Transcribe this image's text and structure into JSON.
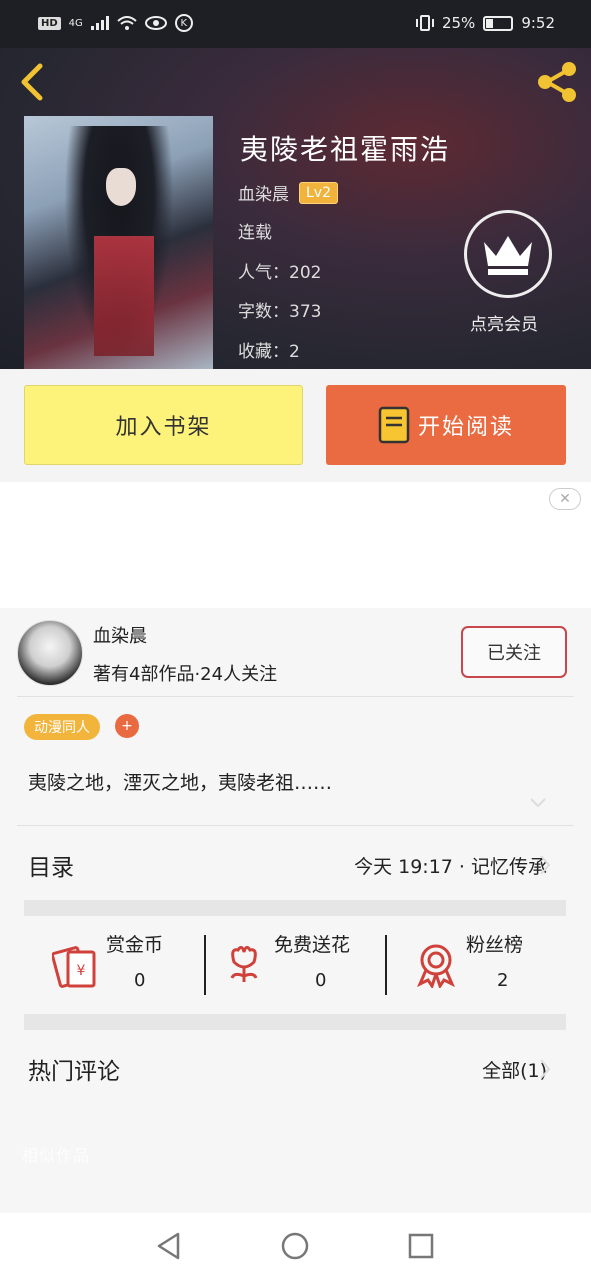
{
  "status": {
    "battery": "25%",
    "time": "9:52",
    "network": "4G"
  },
  "book": {
    "title": "夷陵老祖霍雨浩",
    "author": "血染晨",
    "level": "Lv2",
    "status": "连载",
    "popularity": "人气：202",
    "word_count": "字数：373",
    "favorites": "收藏：2",
    "vip_label": "点亮会员"
  },
  "actions": {
    "add_shelf": "加入书架",
    "start_read": "开始阅读"
  },
  "ad": {
    "close": "✕"
  },
  "author_card": {
    "name": "血染晨",
    "sub": "著有4部作品·24人关注",
    "follow": "已关注"
  },
  "tags": {
    "tag1": "动漫同人",
    "add": "+"
  },
  "intro": "夷陵之地，湮灭之地，夷陵老祖……",
  "catalog": {
    "title": "目录",
    "latest": "今天 19:17 · 记忆传承"
  },
  "stats": {
    "reward_label": "赏金币",
    "reward_value": "0",
    "flower_label": "免费送花",
    "flower_value": "0",
    "fans_label": "粉丝榜",
    "fans_value": "2"
  },
  "comments": {
    "title": "热门评论",
    "all": "全部(1)"
  },
  "ghost_text": "相似作品",
  "colors": {
    "accent": "#ea6b41",
    "shelf": "#fdf27a",
    "tag": "#f2b43a"
  }
}
